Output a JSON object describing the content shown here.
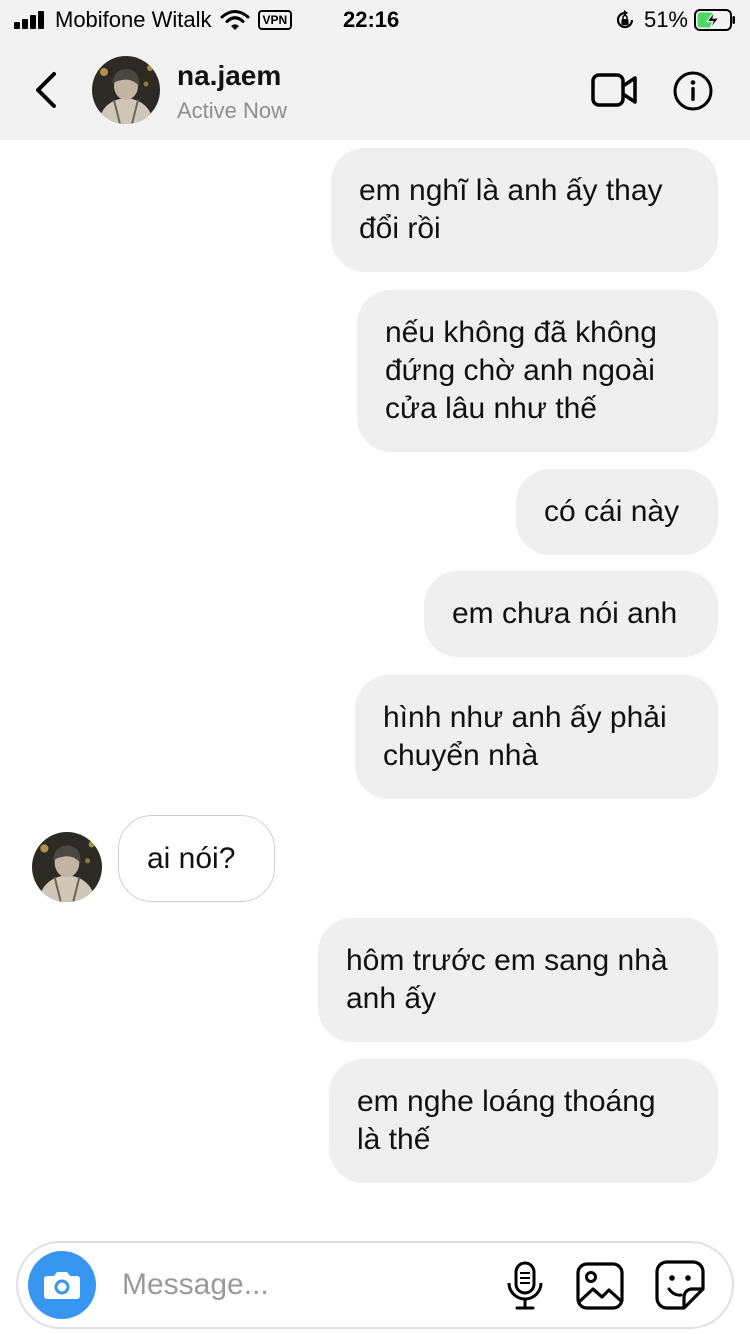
{
  "status_bar": {
    "carrier": "Mobifone Witalk",
    "vpn": "VPN",
    "time": "22:16",
    "battery_percent": "51%",
    "battery_level": 0.51,
    "icons": [
      "signal-icon",
      "wifi-icon",
      "vpn-icon",
      "orientation-lock-icon",
      "battery-charging-icon"
    ]
  },
  "header": {
    "username": "na.jaem",
    "status": "Active Now",
    "icons": [
      "back-icon",
      "video-call-icon",
      "info-icon"
    ]
  },
  "messages": [
    {
      "direction": "outgoing",
      "text": "em nghĩ là anh ấy thay\nđổi rồi"
    },
    {
      "direction": "outgoing",
      "text": "nếu không đã không\nđứng chờ anh ngoài\ncửa lâu như thế"
    },
    {
      "direction": "outgoing",
      "text": "có cái này"
    },
    {
      "direction": "outgoing",
      "text": "em chưa nói anh"
    },
    {
      "direction": "outgoing",
      "text": "hình như anh ấy phải\nchuyển nhà"
    },
    {
      "direction": "incoming",
      "text": "ai nói?"
    },
    {
      "direction": "outgoing",
      "text": "hôm trước em sang nhà\nanh ấy"
    },
    {
      "direction": "outgoing",
      "text": "em nghe loáng thoáng\nlà thế"
    }
  ],
  "composer": {
    "placeholder": "Message...",
    "value": "",
    "icons": [
      "camera-icon",
      "microphone-icon",
      "gallery-icon",
      "sticker-icon"
    ]
  },
  "colors": {
    "bar_background": "#f2f2f2",
    "outgoing_bubble": "#efefef",
    "incoming_bubble": "#ffffff",
    "camera_button": "#3797f0",
    "secondary_text": "#8e8e8e",
    "battery_charging": "#4cd964"
  }
}
